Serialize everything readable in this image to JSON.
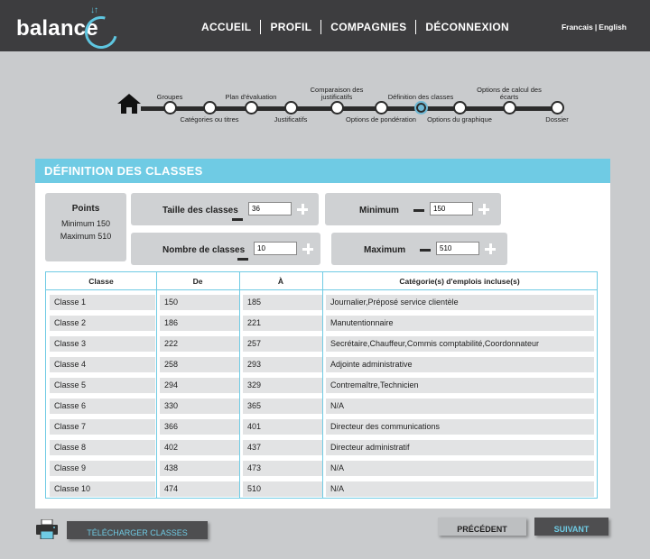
{
  "header": {
    "logo_text": "balance",
    "nav": [
      "ACCUEIL",
      "PROFIL",
      "COMPAGNIES",
      "DÉCONNEXION"
    ],
    "lang_fr": "Francais",
    "lang_sep": "|",
    "lang_en": "English"
  },
  "stepper": {
    "steps": [
      {
        "label": "Groupes"
      },
      {
        "label": "Catégories ou titres"
      },
      {
        "label": "Plan d'évaluation"
      },
      {
        "label": "Justificatifs"
      },
      {
        "label": "Comparaison des justificatifs"
      },
      {
        "label": "Options de pondération"
      },
      {
        "label": "Définition des classes"
      },
      {
        "label": "Options du graphique"
      },
      {
        "label": "Options de calcul des écarts"
      },
      {
        "label": "Dossier"
      }
    ],
    "active_index": 6
  },
  "panel": {
    "title": "DÉFINITION DES CLASSES",
    "points": {
      "title": "Points",
      "minimum": "Minimum 150",
      "maximum": "Maximum 510"
    },
    "taille": {
      "label": "Taille des classes",
      "value": "36"
    },
    "nombre": {
      "label": "Nombre de classes",
      "value": "10"
    },
    "minimum": {
      "label": "Minimum",
      "value": "150"
    },
    "maximum": {
      "label": "Maximum",
      "value": "510"
    }
  },
  "table": {
    "headers": [
      "Classe",
      "De",
      "À",
      "Catégorie(s) d'emplois incluse(s)"
    ],
    "rows": [
      [
        "Classe 1",
        "150",
        "185",
        "Journalier,Préposé service clientèle"
      ],
      [
        "Classe 2",
        "186",
        "221",
        "Manutentionnaire"
      ],
      [
        "Classe 3",
        "222",
        "257",
        "Secrétaire,Chauffeur,Commis comptabilité,Coordonnateur"
      ],
      [
        "Classe 4",
        "258",
        "293",
        "Adjointe administrative"
      ],
      [
        "Classe 5",
        "294",
        "329",
        "Contremaître,Technicien"
      ],
      [
        "Classe 6",
        "330",
        "365",
        "N/A"
      ],
      [
        "Classe 7",
        "366",
        "401",
        "Directeur des communications"
      ],
      [
        "Classe 8",
        "402",
        "437",
        "Directeur administratif"
      ],
      [
        "Classe 9",
        "438",
        "473",
        "N/A"
      ],
      [
        "Classe 10",
        "474",
        "510",
        "N/A"
      ]
    ]
  },
  "footer": {
    "download_label": "TÉLÉCHARGER CLASSES",
    "prev_label": "PRÉCÉDENT",
    "next_label": "SUIVANT"
  },
  "colors": {
    "accent": "#6fcbe4",
    "header_bg": "#3d3d3f",
    "page_bg": "#c9cbcd"
  }
}
